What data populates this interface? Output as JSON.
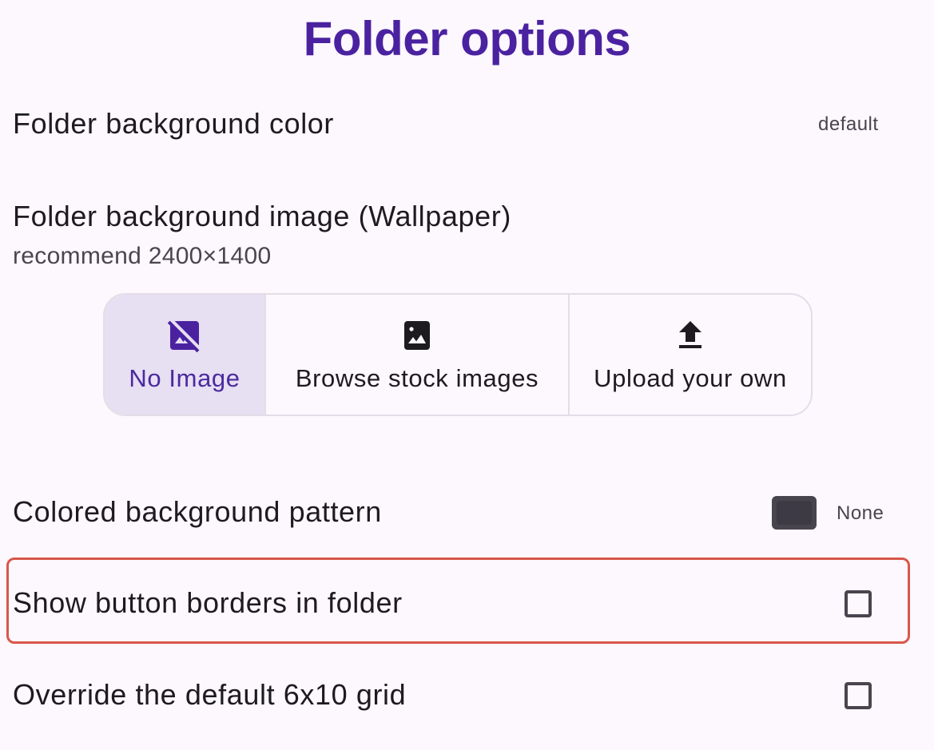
{
  "page": {
    "title": "Folder options"
  },
  "background_color": {
    "label": "Folder background color",
    "value": "default"
  },
  "background_image": {
    "label": "Folder background image (Wallpaper)",
    "hint": "recommend 2400×1400",
    "options": [
      {
        "label": "No Image",
        "icon": "hide-image-icon",
        "selected": true
      },
      {
        "label": "Browse stock images",
        "icon": "image-icon",
        "selected": false
      },
      {
        "label": "Upload your own",
        "icon": "upload-icon",
        "selected": false
      }
    ]
  },
  "background_pattern": {
    "label": "Colored background pattern",
    "value": "None",
    "swatch_color": "#3e3a45"
  },
  "show_borders": {
    "label": "Show button borders in folder",
    "checked": false
  },
  "override_grid": {
    "label": "Override the default 6x10 grid",
    "checked": false
  },
  "colors": {
    "accent": "#4a22a0",
    "highlight": "#d8574a",
    "selected_bg": "#e7dff2",
    "background": "#fdf7fe"
  }
}
